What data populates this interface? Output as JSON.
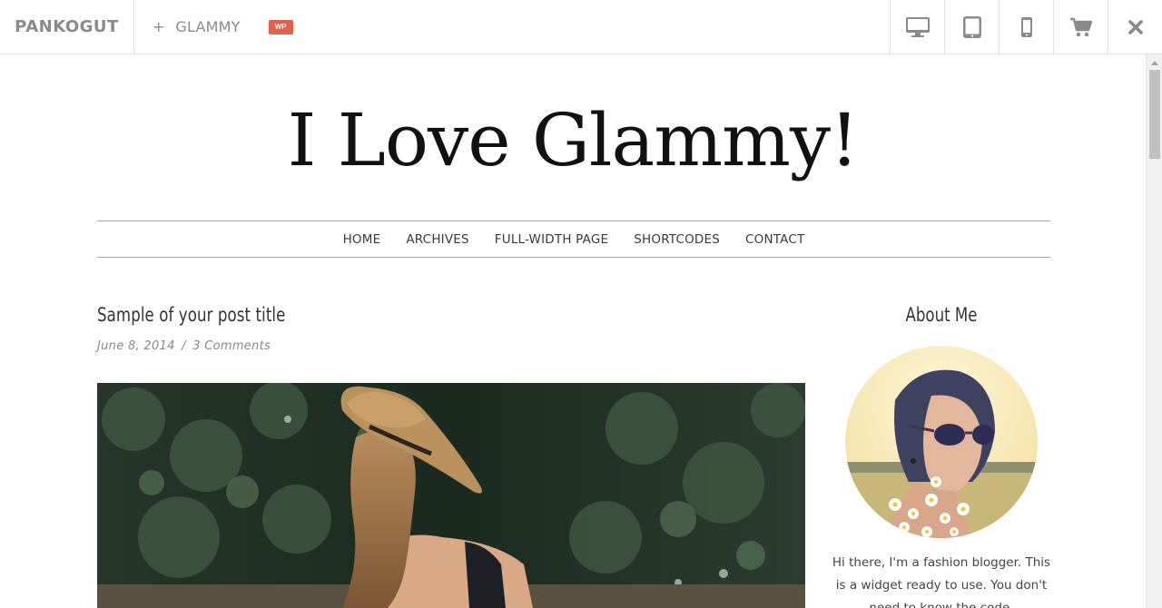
{
  "topbar": {
    "brand": "PANKOGUT",
    "theme_plus": "+",
    "theme_name": "GLAMMY",
    "wp_badge": "WP",
    "tools": [
      "desktop-icon",
      "tablet-icon",
      "mobile-icon",
      "cart-icon",
      "close-icon"
    ]
  },
  "site": {
    "title": "I Love Glammy!",
    "nav": [
      "HOME",
      "ARCHIVES",
      "FULL-WIDTH PAGE",
      "SHORTCODES",
      "CONTACT"
    ],
    "post": {
      "title": "Sample of your post title",
      "date": "June 8, 2014",
      "separator": "/",
      "comments": "3 Comments"
    },
    "sidebar": {
      "widget_title": "About Me",
      "widget_text": "Hi there, I'm a fashion blogger. This is a widget ready to use. You don't need to know the code."
    }
  },
  "colors": {
    "accent_badge": "#e2614b",
    "icon_gray": "#8a8a8a",
    "divider": "#e2e2e2"
  }
}
